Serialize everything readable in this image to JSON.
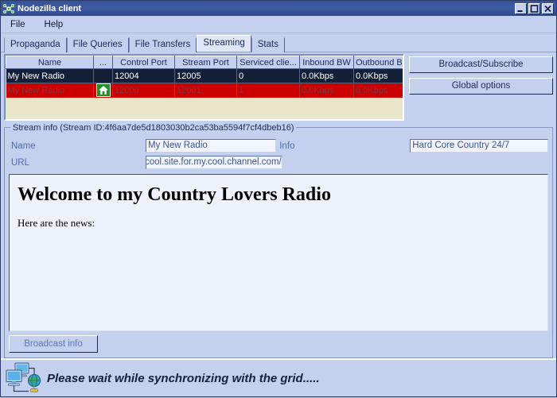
{
  "window": {
    "title": "Nodezilla client",
    "app_icon": "nodezilla-molecule-icon",
    "minimize_label": "Minimize",
    "maximize_label": "Maximize",
    "close_label": "Close"
  },
  "menubar": {
    "items": [
      {
        "label": "File"
      },
      {
        "label": "Help"
      }
    ]
  },
  "tabs": {
    "items": [
      {
        "label": "Propaganda",
        "selected": false
      },
      {
        "label": "File Queries",
        "selected": false
      },
      {
        "label": "File Transfers",
        "selected": false
      },
      {
        "label": "Streaming",
        "selected": true
      },
      {
        "label": "Stats",
        "selected": false
      }
    ]
  },
  "streams_table": {
    "columns": [
      "Name",
      "...",
      "Control Port",
      "Stream Port",
      "Serviced clie...",
      "Inbound BW",
      "Outbound BW"
    ],
    "rows": [
      {
        "name": "My New Radio",
        "icon": "",
        "control_port": "12004",
        "stream_port": "12005",
        "serviced_clients": "0",
        "inbound_bw": "0.0Kbps",
        "outbound_bw": "0.0Kbps",
        "state": "selected"
      },
      {
        "name": "My New Radio",
        "icon": "home-icon",
        "control_port": "12000",
        "stream_port": "12001",
        "serviced_clients": "1",
        "inbound_bw": "0.0Kbps",
        "outbound_bw": "0.0Kbps",
        "state": "highlight"
      }
    ]
  },
  "side_buttons": {
    "broadcast_subscribe": "Broadcast/Subscribe",
    "global_options": "Global options"
  },
  "stream_info": {
    "group_title": "Stream info (Stream ID:4f6aa7de5d1803030b2ca53ba5594f7cf4dbeb16)",
    "stream_id": "4f6aa7de5d1803030b2ca53ba5594f7cf4dbeb16",
    "name_label": "Name",
    "name_value": "My New Radio",
    "url_label": "URL",
    "url_value": "cool.site.for.my.cool.channel.com/",
    "info_label": "Info",
    "info_value": "Hard Core Country 24/7"
  },
  "viewer": {
    "heading": "Welcome to my Country Lovers Radio",
    "paragraph": "Here are the news:"
  },
  "bottom": {
    "broadcast_info_label": "Broadcast info"
  },
  "statusbar": {
    "icon": "network-globe-icon",
    "message": "Please wait while synchronizing with the grid....."
  },
  "colors": {
    "titlebar": "#3e5ca4",
    "face": "#c3d0ee",
    "selected_row": "#142038",
    "highlight_row": "#cc0000",
    "table_empty": "#e9e5c9",
    "field_bg": "#f2f5fd",
    "label_blue": "#4e6bb0"
  }
}
